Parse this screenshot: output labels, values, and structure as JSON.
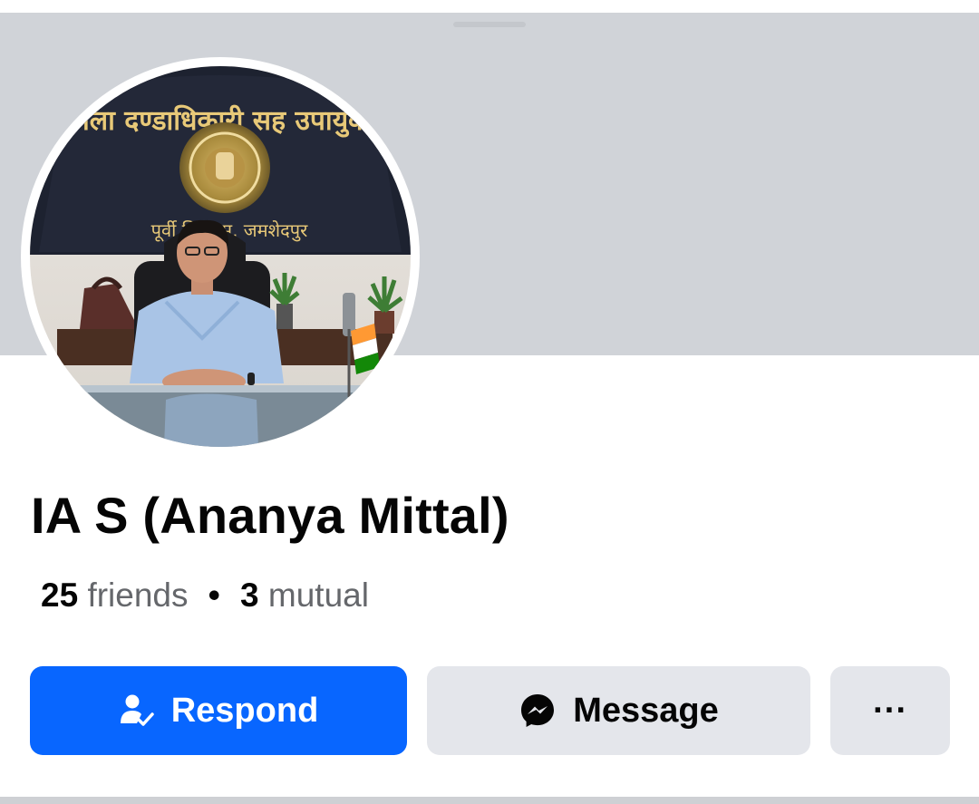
{
  "profile": {
    "name": "IA S (Ananya Mittal)",
    "friends_count": "25",
    "friends_label": "friends",
    "separator": "•",
    "mutual_count": "3",
    "mutual_label": "mutual",
    "photo": {
      "sign_line1": "जिला दण्डाधिकारी सह उपायुक्त",
      "sign_line2": "पूर्वी सिंहभूम, जमशेदपुर"
    }
  },
  "actions": {
    "respond_label": "Respond",
    "message_label": "Message",
    "more_label": "···"
  },
  "icons": {
    "respond": "person-check-icon",
    "message": "messenger-icon"
  },
  "colors": {
    "primary": "#0866ff",
    "secondary_button": "#e4e6eb",
    "cover": "#d0d3d8"
  }
}
